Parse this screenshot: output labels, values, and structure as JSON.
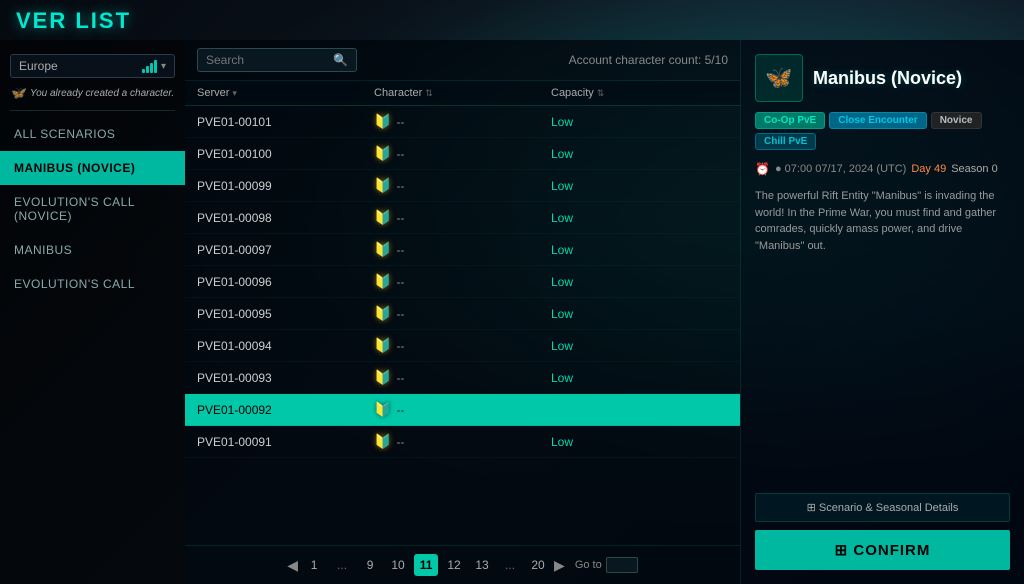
{
  "title": "VER LIST",
  "sidebar": {
    "region": "Europe",
    "char_notice": "You already created a character.",
    "items": [
      {
        "id": "all-scenarios",
        "label": "ALL SCENARIOS",
        "active": false
      },
      {
        "id": "manibus-novice",
        "label": "MANIBUS (NOVICE)",
        "active": true
      },
      {
        "id": "evolutions-call-novice",
        "label": "EVOLUTION'S CALL (NOVICE)",
        "active": false
      },
      {
        "id": "manibus",
        "label": "MANIBUS",
        "active": false
      },
      {
        "id": "evolutions-call",
        "label": "EVOLUTION'S CALL",
        "active": false
      }
    ]
  },
  "table": {
    "account_char_count": "Account character count: 5/10",
    "search_placeholder": "Search",
    "columns": [
      "Server",
      "Character",
      "Capacity"
    ],
    "rows": [
      {
        "server": "PVE01-00101",
        "character": "--",
        "capacity": "Low",
        "selected": false
      },
      {
        "server": "PVE01-00100",
        "character": "--",
        "capacity": "Low",
        "selected": false
      },
      {
        "server": "PVE01-00099",
        "character": "--",
        "capacity": "Low",
        "selected": false
      },
      {
        "server": "PVE01-00098",
        "character": "--",
        "capacity": "Low",
        "selected": false
      },
      {
        "server": "PVE01-00097",
        "character": "--",
        "capacity": "Low",
        "selected": false
      },
      {
        "server": "PVE01-00096",
        "character": "--",
        "capacity": "Low",
        "selected": false
      },
      {
        "server": "PVE01-00095",
        "character": "--",
        "capacity": "Low",
        "selected": false
      },
      {
        "server": "PVE01-00094",
        "character": "--",
        "capacity": "Low",
        "selected": false
      },
      {
        "server": "PVE01-00093",
        "character": "--",
        "capacity": "Low",
        "selected": false
      },
      {
        "server": "PVE01-00092",
        "character": "--",
        "capacity": "",
        "selected": true
      },
      {
        "server": "PVE01-00091",
        "character": "--",
        "capacity": "Low",
        "selected": false
      }
    ],
    "pagination": {
      "prev": "◀",
      "next": "▶",
      "pages": [
        "1",
        "...",
        "9",
        "10",
        "11",
        "12",
        "13",
        "...",
        "20"
      ],
      "active_page": "11",
      "goto_label": "Go to"
    }
  },
  "right_panel": {
    "scenario_icon": "🦋",
    "scenario_title": "Manibus (Novice)",
    "tags": [
      {
        "id": "coop",
        "label": "Co-Op PvE",
        "type": "coop"
      },
      {
        "id": "encounter",
        "label": "Close Encounter",
        "type": "encounter"
      },
      {
        "id": "novice",
        "label": "Novice",
        "type": "novice"
      },
      {
        "id": "chill",
        "label": "Chill PvE",
        "type": "chill"
      }
    ],
    "time": "● 07:00 07/17, 2024 (UTC)",
    "day": "Day 49",
    "season": "Season 0",
    "description": "The powerful Rift Entity \"Manibus\" is invading the world! In the Prime War, you must find and gather comrades, quickly amass power, and drive \"Manibus\" out.",
    "details_btn": "⊞ Scenario & Seasonal Details",
    "confirm_btn": "⊞ CONFIRM"
  }
}
